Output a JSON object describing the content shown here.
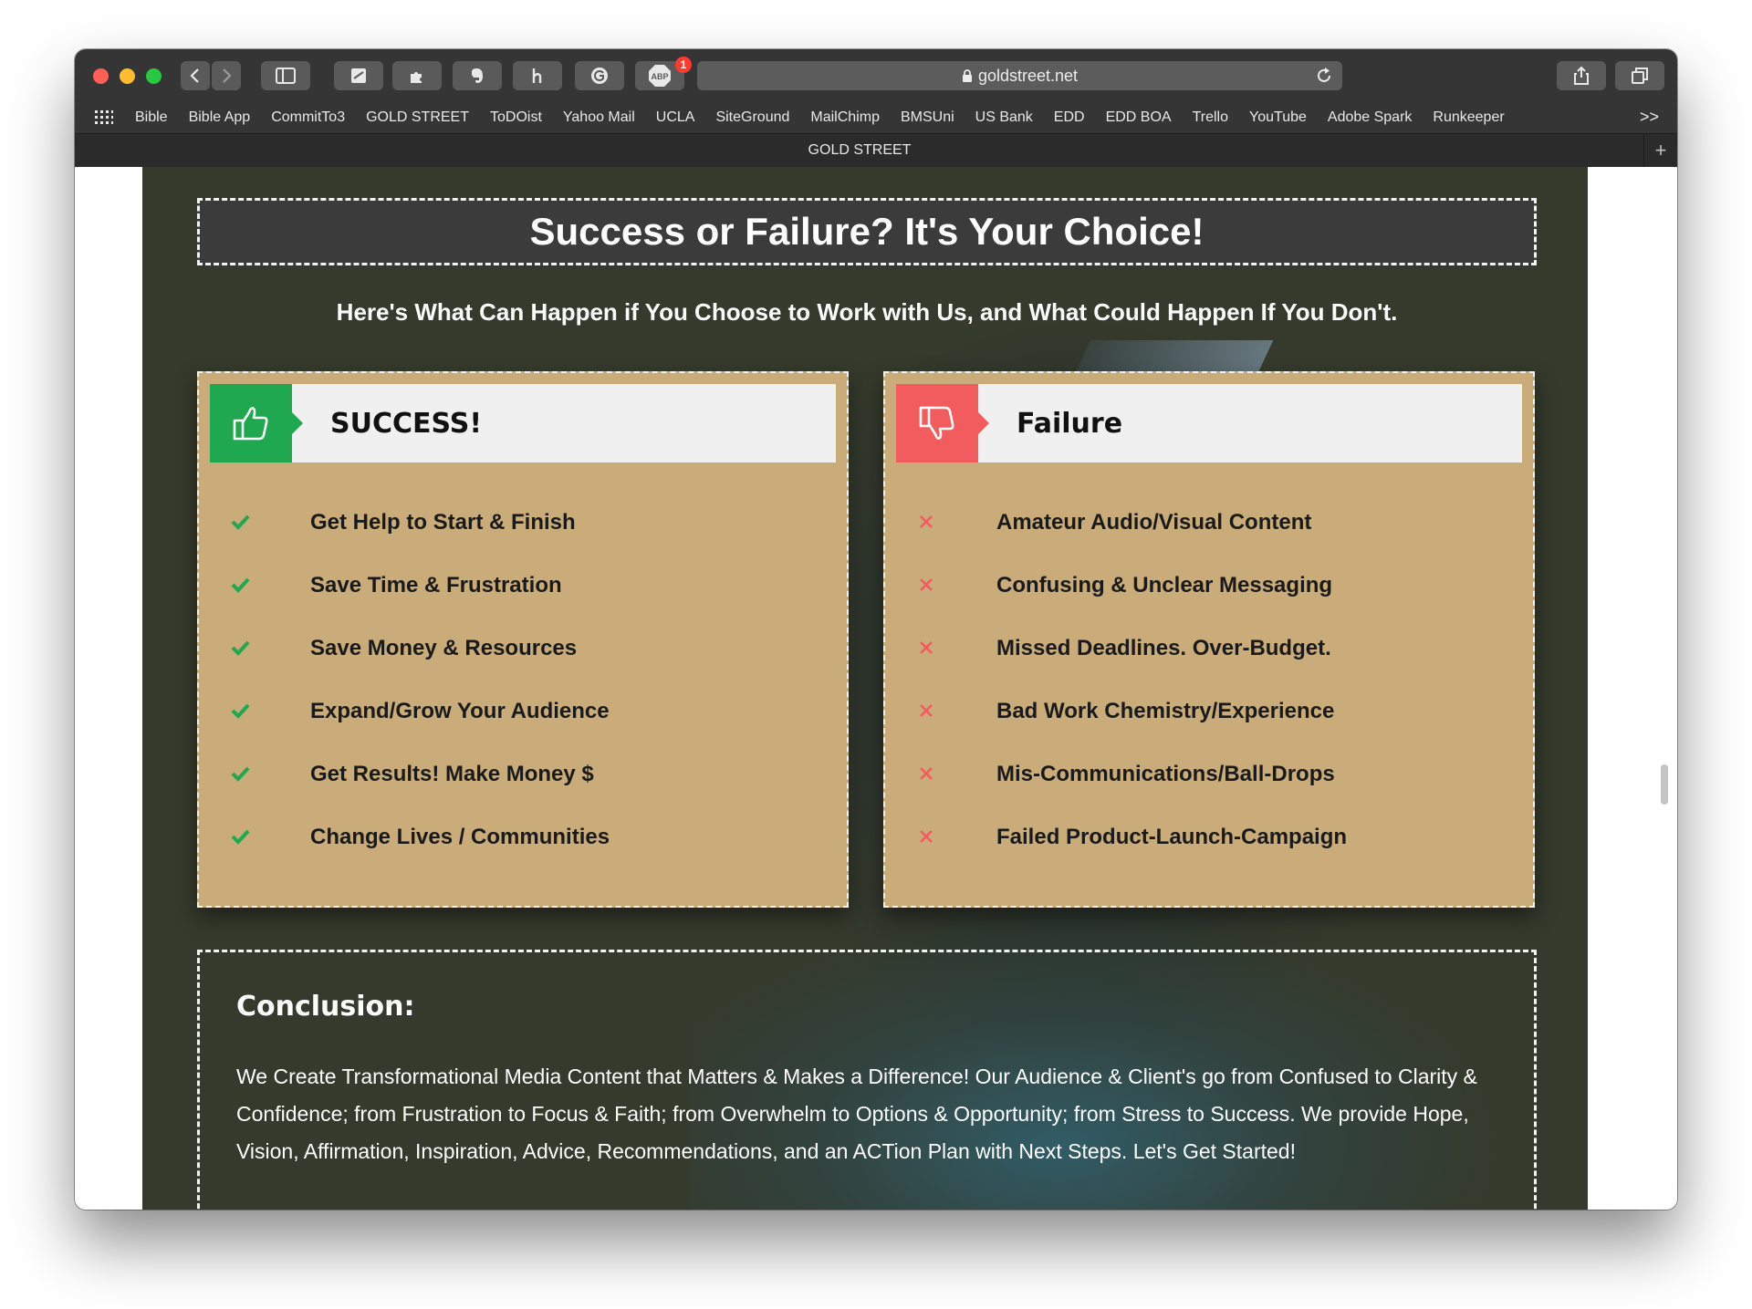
{
  "browser": {
    "url": "goldstreet.net",
    "notification_badge": "1",
    "bookmarks": [
      "Bible",
      "Bible App",
      "CommitTo3",
      "GOLD STREET",
      "ToDOist",
      "Yahoo Mail",
      "UCLA",
      "SiteGround",
      "MailChimp",
      "BMSUni",
      "US Bank",
      "EDD",
      "EDD BOA",
      "Trello",
      "YouTube",
      "Adobe Spark",
      "Runkeeper"
    ],
    "bookmarks_more": ">>",
    "tab_title": "GOLD STREET"
  },
  "page": {
    "heading": "Success or Failure? It's Your Choice!",
    "subheading": "Here's What Can Happen if You Choose to Work with Us, and What Could Happen If You Don't.",
    "success": {
      "title": "SUCCESS!",
      "items": [
        "Get Help to Start & Finish",
        "Save Time & Frustration",
        "Save Money & Resources",
        "Expand/Grow Your Audience",
        "Get Results! Make Money $",
        "Change Lives / Communities"
      ]
    },
    "failure": {
      "title": "Failure",
      "items": [
        "Amateur Audio/Visual Content",
        "Confusing & Unclear Messaging",
        "Missed Deadlines. Over-Budget.",
        "Bad Work Chemistry/Experience",
        "Mis-Communications/Ball-Drops",
        "Failed Product-Launch-Campaign"
      ]
    },
    "conclusion": {
      "title": "Conclusion:",
      "body": "We Create Transformational Media Content that Matters & Makes a Difference! Our Audience & Client's go from Confused to Clarity & Confidence; from Frustration to Focus & Faith; from Overwhelm to Options & Opportunity; from Stress to Success. We provide Hope, Vision, Affirmation, Inspiration, Advice, Recommendations, and an ACTion Plan with Next Steps. Let's Get Started!"
    }
  },
  "colors": {
    "success_green": "#1fa84f",
    "failure_red": "#f25c5f",
    "card_tan": "#c9ac7a",
    "page_bg": "#353a2c"
  }
}
